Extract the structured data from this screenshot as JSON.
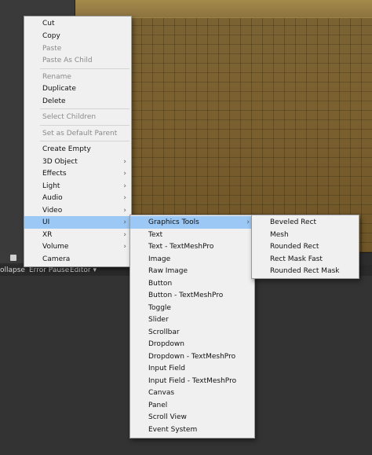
{
  "console": {
    "collapse": "ollapse",
    "error_pause": "Error Pause",
    "editor": "Editor",
    "editor_caret": "▾"
  },
  "arrow": "›",
  "context_menu": {
    "cut": "Cut",
    "copy": "Copy",
    "paste": "Paste",
    "paste_as_child": "Paste As Child",
    "rename": "Rename",
    "duplicate": "Duplicate",
    "delete": "Delete",
    "select_children": "Select Children",
    "set_default_parent": "Set as Default Parent",
    "create_empty": "Create Empty",
    "object_3d": "3D Object",
    "effects": "Effects",
    "light": "Light",
    "audio": "Audio",
    "video": "Video",
    "ui": "UI",
    "xr": "XR",
    "volume": "Volume",
    "camera": "Camera"
  },
  "ui_menu": {
    "graphics_tools": "Graphics Tools",
    "text": "Text",
    "text_tmp": "Text - TextMeshPro",
    "image": "Image",
    "raw_image": "Raw Image",
    "button": "Button",
    "button_tmp": "Button - TextMeshPro",
    "toggle": "Toggle",
    "slider": "Slider",
    "scrollbar": "Scrollbar",
    "dropdown": "Dropdown",
    "dropdown_tmp": "Dropdown - TextMeshPro",
    "input_field": "Input Field",
    "input_field_tmp": "Input Field - TextMeshPro",
    "canvas": "Canvas",
    "panel": "Panel",
    "scroll_view": "Scroll View",
    "event_system": "Event System"
  },
  "graphics_menu": {
    "beveled_rect": "Beveled Rect",
    "mesh": "Mesh",
    "rounded_rect": "Rounded Rect",
    "rect_mask_fast": "Rect Mask Fast",
    "rounded_rect_mask": "Rounded Rect Mask"
  }
}
